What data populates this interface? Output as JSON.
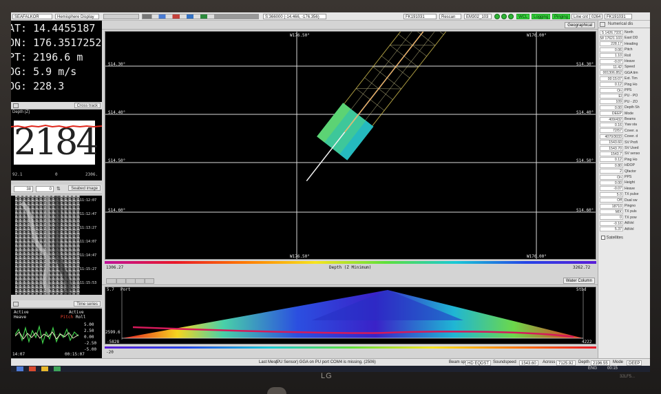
{
  "toolbar": {
    "app_menu": "SEAFALKOR",
    "display_mode": "Hemisphere Display",
    "view_mode": "Geographical",
    "coord_readout": "S:366000 (-14.466, -176.356)",
    "survey_line": "FK191031",
    "rescan_label": "Rescan",
    "sonar_model": "EM302_103",
    "status_chips": [
      "WCL",
      "Logging",
      "Pinging"
    ],
    "line_cnt_label": "Line cnt",
    "line_cnt_value": "0264",
    "survey_right": "FK191031"
  },
  "nav": {
    "lat": "AT: 14.4455187",
    "lon": "ON: 176.3517252",
    "depth": "PT: 2196.6 m",
    "sog": "OG: 5.9 m/s",
    "cog": "OG: 228.3"
  },
  "depth_panel": {
    "header": "Cross track",
    "title": "Depth (Z)",
    "value": "2184",
    "foot_left": "92.1",
    "foot_mid": "0",
    "foot_right": "2306."
  },
  "seabed_panel": {
    "header": "Seabed image",
    "spin_a": "38",
    "spin_b": "0",
    "ticks": [
      "11:12:07",
      "11:12:47",
      "11:13:27",
      "11:14:07",
      "11:14:47",
      "11:15:27",
      "11:15:53"
    ]
  },
  "time_panel": {
    "header": "Time series",
    "label_active_left": "Active",
    "label_heave": "Heave",
    "label_active_right": "Active",
    "label_pitch": "Pitch",
    "label_roll": "Roll",
    "y_ticks": [
      "5.00",
      "2.50",
      "0.00",
      "-2.50",
      "-5.00"
    ],
    "t_start": "14:07",
    "t_end": "00:15:07"
  },
  "map": {
    "lon_top_left": "W176.50°",
    "lon_top_right": "W176.00°",
    "lon_bottom_left": "W176.50°",
    "lon_bottom_right": "W176.00°",
    "lat_labels": [
      "S14.30°",
      "S14.40°",
      "S14.50°",
      "S14.60°"
    ],
    "depth_min": "1306.27",
    "depth_max": "3262.72",
    "depth_title": "Depth (Z Minimum)"
  },
  "water_column": {
    "header": "Water Column",
    "port": "Port",
    "stbd": "Stbd",
    "top_depth": "5.7",
    "bottom_depth": "2599.6",
    "left_across": "-5828",
    "right_across": "4222",
    "bar_left": "-20"
  },
  "numerical": {
    "header": "Numerical dis",
    "rows": [
      {
        "v": "S 1426.7331",
        "l": "North"
      },
      {
        "v": "W 17621.103",
        "l": "East DD"
      },
      {
        "v": "228.17",
        "l": "Heading"
      },
      {
        "v": "0.06",
        "l": "Pitch"
      },
      {
        "v": "1.10",
        "l": "Roll"
      },
      {
        "v": "-0.07",
        "l": "Heave"
      },
      {
        "v": "11.42",
        "l": "Speed"
      },
      {
        "v": "001306.852",
        "l": "GGA tim"
      },
      {
        "v": "00:15:07",
        "l": "Ext. Tim"
      },
      {
        "v": "0.12",
        "l": "Ping Ho"
      },
      {
        "v": "On",
        "l": "PPS"
      },
      {
        "v": "El",
        "l": "PU - PO"
      },
      {
        "v": "109",
        "l": "PU - ZO"
      },
      {
        "v": "0.00",
        "l": "Depth Sh"
      },
      {
        "v": "DEEP",
        "l": "Mode"
      },
      {
        "v": "409/432",
        "l": "Beams"
      },
      {
        "v": "0.16",
        "l": "Yaw sta"
      },
      {
        "v": "72/57",
        "l": "Cover. a"
      },
      {
        "v": "4070/3033",
        "l": "Cover. d"
      },
      {
        "v": "1543.60",
        "l": "SV Profi"
      },
      {
        "v": "1543.70",
        "l": "SV Used"
      },
      {
        "v": "1543.7",
        "l": "SV senso"
      },
      {
        "v": "0.12",
        "l": "Ping Ho"
      },
      {
        "v": "0.80",
        "l": "HDOP"
      },
      {
        "v": "2",
        "l": "Qfactor"
      },
      {
        "v": "On",
        "l": "PPS"
      },
      {
        "v": "0.00",
        "l": "Height"
      },
      {
        "v": "-0.07",
        "l": "Heave"
      },
      {
        "v": "5.0",
        "l": "TX pulse"
      },
      {
        "v": "Off",
        "l": "Dual sw"
      },
      {
        "v": "18710",
        "l": "Pingno"
      },
      {
        "v": "MIX",
        "l": "TX puls"
      },
      {
        "v": "0",
        "l": "TX pow"
      },
      {
        "v": "-0.16",
        "l": "AttVel"
      },
      {
        "v": "5.37",
        "l": "AttVel"
      }
    ],
    "satellites": "Satellites"
  },
  "status_bar": {
    "last_msg_label": "Last Mess.",
    "last_msg": "(PU Sensor) GGA on PU port COM4 is missing. (2506)",
    "beam_label": "Beam sp.",
    "beam_value": "HD EQDST",
    "sound_label": "Soundspeed",
    "sound_value": "1543.60",
    "across_label": "Across",
    "across_value": "7125.92",
    "depth_label": "Depth",
    "depth_value": "2196.55",
    "mode_label": "Mode",
    "mode_value": "DEEP",
    "lang": "ENG",
    "clock": "00:15"
  },
  "monitor": {
    "brand": "LG",
    "model": "32LF5..."
  },
  "colors": {
    "map_bg": "#000000",
    "status_green": "#36d33c",
    "ui_grey": "#d9d9d9"
  }
}
